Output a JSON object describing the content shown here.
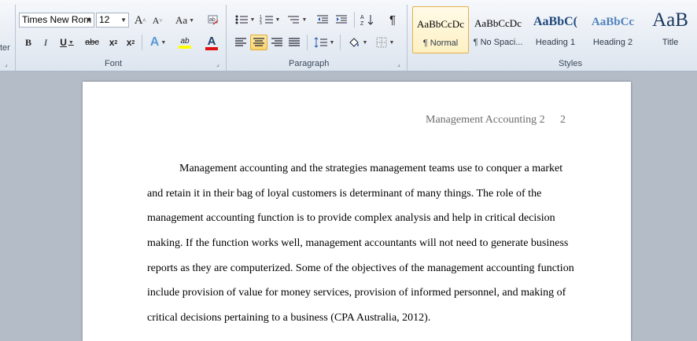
{
  "clipboard": {
    "label_partial": "ter"
  },
  "font": {
    "name": "Times New Rom",
    "size": "12",
    "group_label": "Font",
    "grow_label": "A",
    "shrink_label": "A",
    "change_case_label": "Aa",
    "bold": "B",
    "italic": "I",
    "underline": "U",
    "strike": "abc",
    "subscript": "x",
    "superscript": "x",
    "text_effects": "A",
    "highlight": "ab",
    "font_color": "A",
    "highlight_color": "#ffff00",
    "font_color_value": "#e01010"
  },
  "paragraph": {
    "group_label": "Paragraph",
    "pilcrow": "¶"
  },
  "styles": {
    "group_label": "Styles",
    "items": [
      {
        "sample": "AaBbCcDc",
        "name": "¶ Normal"
      },
      {
        "sample": "AaBbCcDc",
        "name": "¶ No Spaci..."
      },
      {
        "sample": "AaBbC(",
        "name": "Heading 1"
      },
      {
        "sample": "AaBbCc",
        "name": "Heading 2"
      },
      {
        "sample": "AaB",
        "name": "Title"
      }
    ]
  },
  "document": {
    "header_title": "Management Accounting 2",
    "page_number": "2",
    "lines": [
      "Management accounting and the strategies management teams use to conquer a market",
      "and retain it in their bag of loyal customers is determinant of many things. The role of the",
      "management accounting function is to provide complex analysis and help in critical decision",
      "making. If the function works well, management accountants will not need to generate business",
      "reports as they are computerized. Some of the objectives of the management accounting function",
      "include provision of value for money services, provision of informed personnel, and making of",
      "critical decisions pertaining to a business (CPA Australia, 2012)."
    ]
  }
}
